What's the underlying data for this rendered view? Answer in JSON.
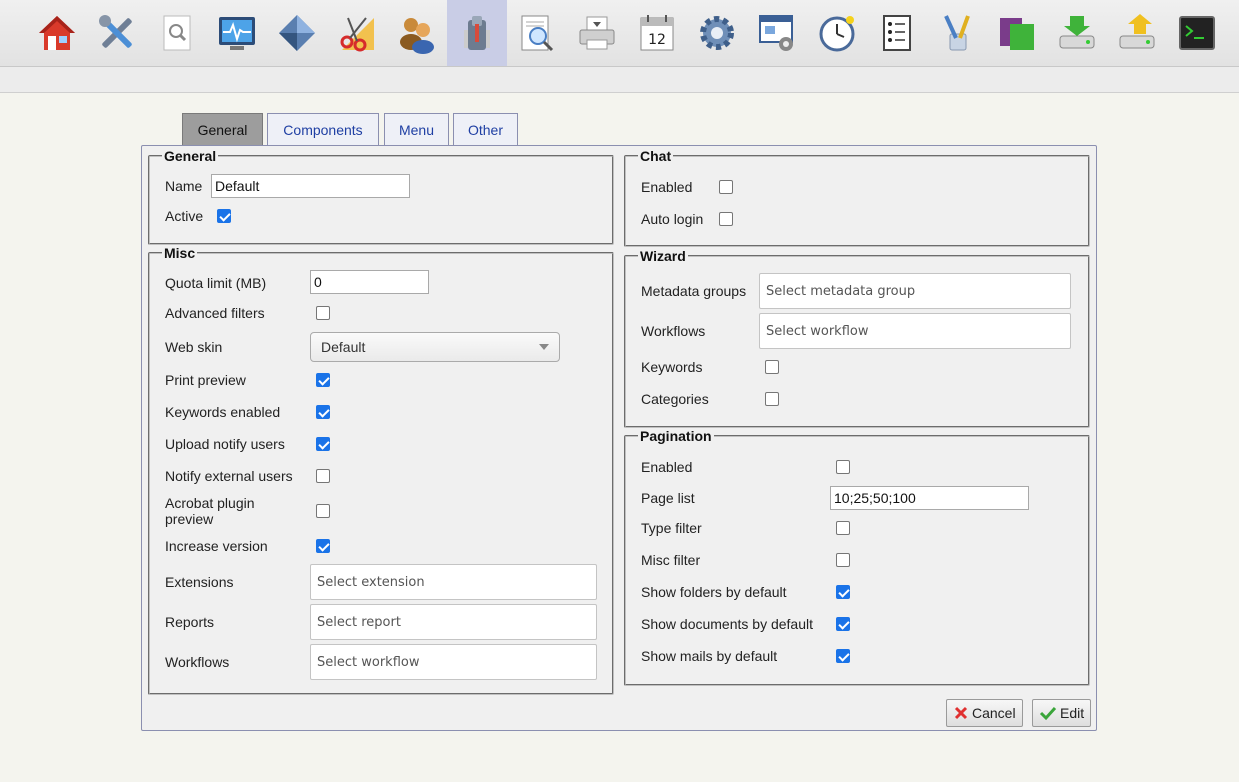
{
  "toolbar": {
    "icons": [
      "home-icon",
      "tools-icon",
      "search-document-icon",
      "monitor-icon",
      "diamond-icon",
      "scissors-ruler-icon",
      "users-icon",
      "user-config-icon",
      "magnifier-page-icon",
      "printer-icon",
      "calendar-icon",
      "gear-icon",
      "window-settings-icon",
      "clock-icon",
      "list-icon",
      "brush-icon",
      "folders-icon",
      "drive-import-icon",
      "drive-export-icon",
      "terminal-icon"
    ],
    "calendar_day": "12",
    "active_index": 7
  },
  "tabs": [
    "General",
    "Components",
    "Menu",
    "Other"
  ],
  "general": {
    "legend": "General",
    "name_label": "Name",
    "name_value": "Default",
    "active_label": "Active"
  },
  "misc": {
    "legend": "Misc",
    "quota_label": "Quota limit (MB)",
    "quota_value": "0",
    "advanced_filters_label": "Advanced filters",
    "web_skin_label": "Web skin",
    "web_skin_value": "Default",
    "print_preview_label": "Print preview",
    "keywords_enabled_label": "Keywords enabled",
    "upload_notify_label": "Upload notify users",
    "notify_external_label": "Notify external users",
    "acrobat_label": "Acrobat plugin preview",
    "increase_version_label": "Increase version",
    "extensions_label": "Extensions",
    "extensions_placeholder": "Select extension",
    "reports_label": "Reports",
    "reports_placeholder": "Select report",
    "workflows_label": "Workflows",
    "workflows_placeholder": "Select workflow"
  },
  "chat": {
    "legend": "Chat",
    "enabled_label": "Enabled",
    "auto_login_label": "Auto login"
  },
  "wizard": {
    "legend": "Wizard",
    "metadata_label": "Metadata groups",
    "metadata_placeholder": "Select metadata group",
    "workflows_label": "Workflows",
    "workflows_placeholder": "Select workflow",
    "keywords_label": "Keywords",
    "categories_label": "Categories"
  },
  "pagination": {
    "legend": "Pagination",
    "enabled_label": "Enabled",
    "page_list_label": "Page list",
    "page_list_value": "10;25;50;100",
    "type_filter_label": "Type filter",
    "misc_filter_label": "Misc filter",
    "show_folders_label": "Show folders by default",
    "show_documents_label": "Show documents by default",
    "show_mails_label": "Show mails by default"
  },
  "actions": {
    "cancel_label": "Cancel",
    "edit_label": "Edit"
  },
  "colors": {
    "accent": "#1a73e8",
    "tab_active": "#9d9d9d",
    "toolbar_active": "#c9cde6"
  }
}
